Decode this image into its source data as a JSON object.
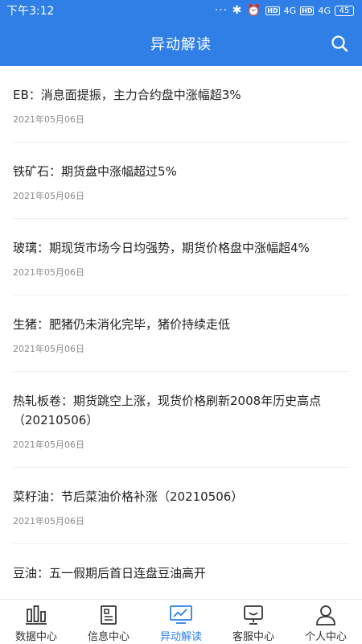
{
  "status_bar": {
    "time": "下午3:12",
    "indicators": "··· ✱ ⏰",
    "hd1": "HD",
    "net1": "4G",
    "hd2": "HD",
    "net2": "4G",
    "battery": "45"
  },
  "header": {
    "title": "异动解读",
    "search_icon": "search-icon"
  },
  "news": [
    {
      "title": "EB：消息面提振，主力合约盘中涨幅超3%",
      "date": "2021年05月06日"
    },
    {
      "title": "铁矿石：期货盘中涨幅超过5%",
      "date": "2021年05月06日"
    },
    {
      "title": "玻璃：期现货市场今日均强势，期货价格盘中涨幅超4%",
      "date": "2021年05月06日"
    },
    {
      "title": "生猪：肥猪仍未消化完毕，猪价持续走低",
      "date": "2021年05月06日"
    },
    {
      "title": "热轧板卷：期货跳空上涨，现货价格刷新2008年历史高点（20210506）",
      "date": "2021年05月06日"
    },
    {
      "title": "菜籽油：节后菜油价格补涨（20210506）",
      "date": "2021年05月06日"
    },
    {
      "title": "豆油：五一假期后首日连盘豆油高开",
      "date": ""
    }
  ],
  "tabbar": {
    "tabs": [
      {
        "label": "数据中心",
        "icon": "bar-chart-icon"
      },
      {
        "label": "信息中心",
        "icon": "document-icon"
      },
      {
        "label": "异动解读",
        "icon": "monitor-chart-icon"
      },
      {
        "label": "客服中心",
        "icon": "headset-icon"
      },
      {
        "label": "个人中心",
        "icon": "user-icon"
      }
    ],
    "active_index": 2
  },
  "colors": {
    "primary": "#2f7fe6",
    "text": "#222222",
    "date": "#8a8a8a"
  }
}
